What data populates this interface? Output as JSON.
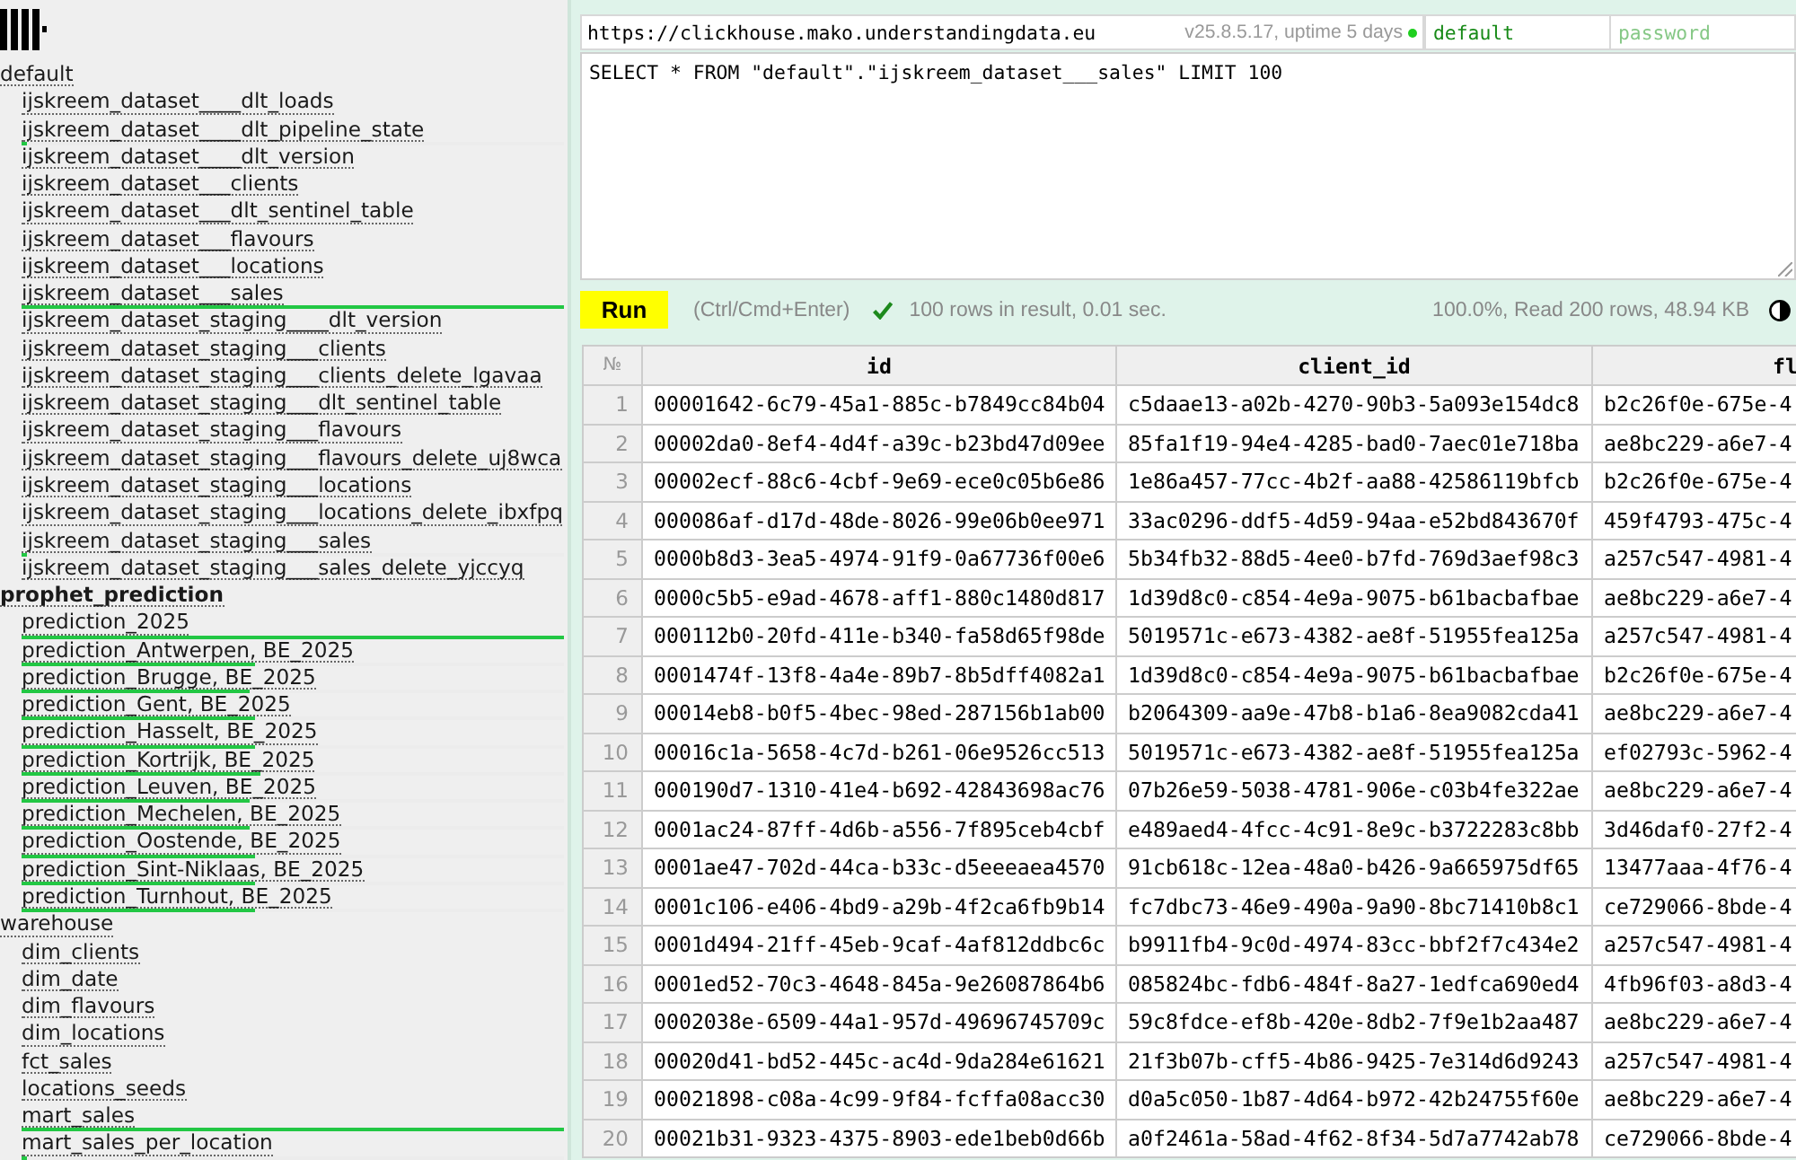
{
  "sidebar": {
    "databases": [
      {
        "name": "default",
        "selected": false,
        "children": [
          {
            "name": "ijskreem_dataset____dlt_loads"
          },
          {
            "name": "ijskreem_dataset____dlt_pipeline_state",
            "level": 0.01
          },
          {
            "name": "ijskreem_dataset____dlt_version"
          },
          {
            "name": "ijskreem_dataset___clients"
          },
          {
            "name": "ijskreem_dataset___dlt_sentinel_table"
          },
          {
            "name": "ijskreem_dataset___flavours"
          },
          {
            "name": "ijskreem_dataset___locations"
          },
          {
            "name": "ijskreem_dataset___sales",
            "level": 1
          },
          {
            "name": "ijskreem_dataset_staging____dlt_version"
          },
          {
            "name": "ijskreem_dataset_staging___clients"
          },
          {
            "name": "ijskreem_dataset_staging___clients_delete_lgavaa"
          },
          {
            "name": "ijskreem_dataset_staging___dlt_sentinel_table"
          },
          {
            "name": "ijskreem_dataset_staging___flavours"
          },
          {
            "name": "ijskreem_dataset_staging___flavours_delete_uj8wca"
          },
          {
            "name": "ijskreem_dataset_staging___locations"
          },
          {
            "name": "ijskreem_dataset_staging___locations_delete_ibxfpq"
          },
          {
            "name": "ijskreem_dataset_staging___sales",
            "level": 0.01
          },
          {
            "name": "ijskreem_dataset_staging___sales_delete_yjccyq"
          }
        ]
      },
      {
        "name": "prophet_prediction",
        "selected": true,
        "children": [
          {
            "name": "prediction_2025",
            "level": 1
          },
          {
            "name": "prediction_Antwerpen, BE_2025",
            "level": 0.43
          },
          {
            "name": "prediction_Brugge, BE_2025",
            "level": 0.42
          },
          {
            "name": "prediction_Gent, BE_2025",
            "level": 0.43
          },
          {
            "name": "prediction_Hasselt, BE_2025",
            "level": 0.43
          },
          {
            "name": "prediction_Kortrijk, BE_2025",
            "level": 0.44
          },
          {
            "name": "prediction_Leuven, BE_2025",
            "level": 0.42
          },
          {
            "name": "prediction_Mechelen, BE_2025",
            "level": 0.42
          },
          {
            "name": "prediction_Oostende, BE_2025",
            "level": 0.43
          },
          {
            "name": "prediction_Sint-Niklaas, BE_2025",
            "level": 0.43
          },
          {
            "name": "prediction_Turnhout, BE_2025",
            "level": 0.43
          }
        ]
      },
      {
        "name": "warehouse",
        "selected": false,
        "children": [
          {
            "name": "dim_clients"
          },
          {
            "name": "dim_date"
          },
          {
            "name": "dim_flavours"
          },
          {
            "name": "dim_locations"
          },
          {
            "name": "fct_sales"
          },
          {
            "name": "locations_seeds"
          },
          {
            "name": "mart_sales",
            "level": 1
          },
          {
            "name": "mart_sales_per_location",
            "level": 0.01
          }
        ]
      }
    ]
  },
  "connection": {
    "url": "https://clickhouse.mako.understandingdata.eu",
    "server_info": "v25.8.5.17, uptime 5 days",
    "connected": true,
    "user_field": {
      "value": "default"
    },
    "password_field": {
      "placeholder": "password"
    }
  },
  "query": "SELECT * FROM \"default\".\"ijskreem_dataset___sales\" LIMIT 100",
  "toolbar": {
    "run_button": "Run",
    "shortcut_hint": "(Ctrl/Cmd+Enter)",
    "success": true,
    "summary": "100 rows in result, 0.01 sec.",
    "progress": "100.0%, Read 200 rows, 48.94 KB"
  },
  "results": {
    "columns": [
      "№",
      "id",
      "client_id",
      "fl"
    ],
    "rows": [
      [
        "1",
        "00001642-6c79-45a1-885c-b7849cc84b04",
        "c5daae13-a02b-4270-90b3-5a093e154dc8",
        "b2c26f0e-675e-4"
      ],
      [
        "2",
        "00002da0-8ef4-4d4f-a39c-b23bd47d09ee",
        "85fa1f19-94e4-4285-bad0-7aec01e718ba",
        "ae8bc229-a6e7-4"
      ],
      [
        "3",
        "00002ecf-88c6-4cbf-9e69-ece0c05b6e86",
        "1e86a457-77cc-4b2f-aa88-42586119bfcb",
        "b2c26f0e-675e-4"
      ],
      [
        "4",
        "000086af-d17d-48de-8026-99e06b0ee971",
        "33ac0296-ddf5-4d59-94aa-e52bd843670f",
        "459f4793-475c-4"
      ],
      [
        "5",
        "0000b8d3-3ea5-4974-91f9-0a67736f00e6",
        "5b34fb32-88d5-4ee0-b7fd-769d3aef98c3",
        "a257c547-4981-4"
      ],
      [
        "6",
        "0000c5b5-e9ad-4678-aff1-880c1480d817",
        "1d39d8c0-c854-4e9a-9075-b61bacbafbae",
        "ae8bc229-a6e7-4"
      ],
      [
        "7",
        "000112b0-20fd-411e-b340-fa58d65f98de",
        "5019571c-e673-4382-ae8f-51955fea125a",
        "a257c547-4981-4"
      ],
      [
        "8",
        "0001474f-13f8-4a4e-89b7-8b5dff4082a1",
        "1d39d8c0-c854-4e9a-9075-b61bacbafbae",
        "b2c26f0e-675e-4"
      ],
      [
        "9",
        "00014eb8-b0f5-4bec-98ed-287156b1ab00",
        "b2064309-aa9e-47b8-b1a6-8ea9082cda41",
        "ae8bc229-a6e7-4"
      ],
      [
        "10",
        "00016c1a-5658-4c7d-b261-06e9526cc513",
        "5019571c-e673-4382-ae8f-51955fea125a",
        "ef02793c-5962-4"
      ],
      [
        "11",
        "000190d7-1310-41e4-b692-42843698ac76",
        "07b26e59-5038-4781-906e-c03b4fe322ae",
        "ae8bc229-a6e7-4"
      ],
      [
        "12",
        "0001ac24-87ff-4d6b-a556-7f895ceb4cbf",
        "e489aed4-4fcc-4c91-8e9c-b3722283c8bb",
        "3d46daf0-27f2-4"
      ],
      [
        "13",
        "0001ae47-702d-44ca-b33c-d5eeeaea4570",
        "91cb618c-12ea-48a0-b426-9a665975df65",
        "13477aaa-4f76-4"
      ],
      [
        "14",
        "0001c106-e406-4bd9-a29b-4f2ca6fb9b14",
        "fc7dbc73-46e9-490a-9a90-8bc71410b8c1",
        "ce729066-8bde-4"
      ],
      [
        "15",
        "0001d494-21ff-45eb-9caf-4af812ddbc6c",
        "b9911fb4-9c0d-4974-83cc-bbf2f7c434e2",
        "a257c547-4981-4"
      ],
      [
        "16",
        "0001ed52-70c3-4648-845a-9e26087864b6",
        "085824bc-fdb6-484f-8a27-1edfca690ed4",
        "4fb96f03-a8d3-4"
      ],
      [
        "17",
        "0002038e-6509-44a1-957d-49696745709c",
        "59c8fdce-ef8b-420e-8db2-7f9e1b2aa487",
        "ae8bc229-a6e7-4"
      ],
      [
        "18",
        "00020d41-bd52-445c-ac4d-9da284e61621",
        "21f3b07b-cff5-4b86-9425-7e314d6d9243",
        "a257c547-4981-4"
      ],
      [
        "19",
        "00021898-c08a-4c99-9f84-fcffa08acc30",
        "d0a5c050-1b87-4d64-b972-42b24755f60e",
        "ae8bc229-a6e7-4"
      ],
      [
        "20",
        "00021b31-9323-4375-8903-ede1beb0d66b",
        "a0f2461a-58ad-4f62-8f34-5d7a7742ab78",
        "ce729066-8bde-4"
      ]
    ]
  }
}
